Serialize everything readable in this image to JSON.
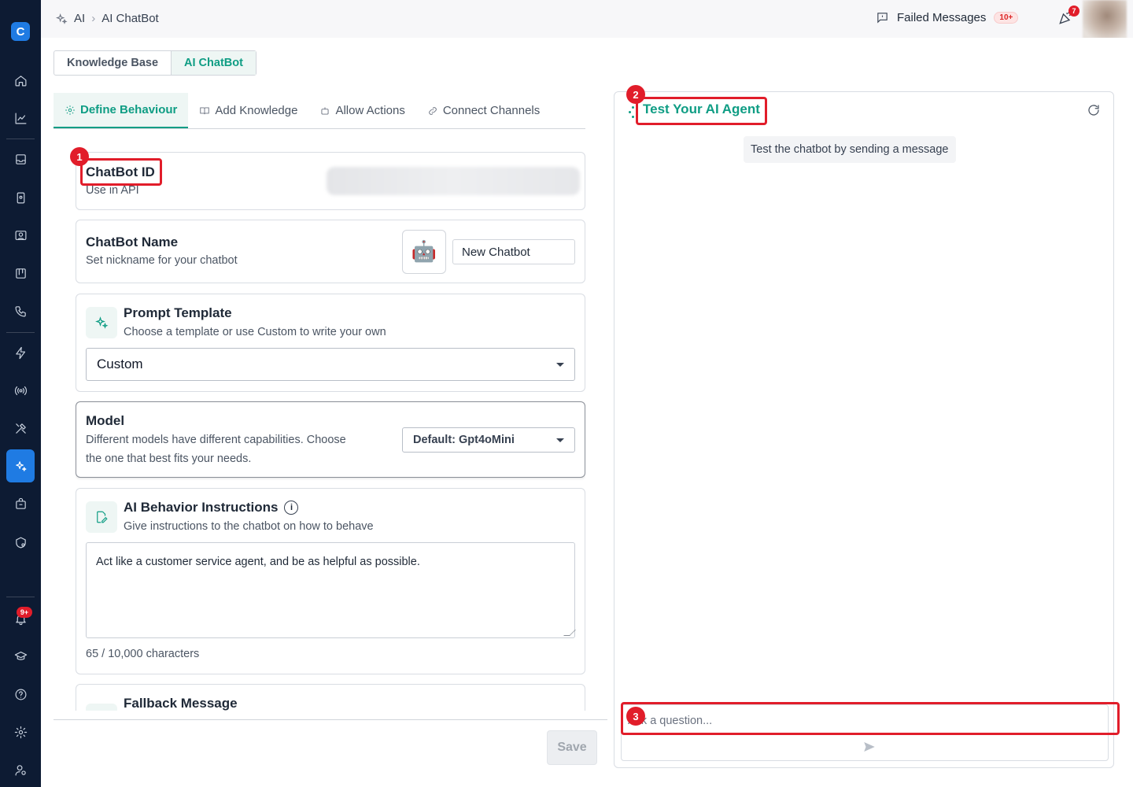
{
  "breadcrumb": {
    "root": "AI",
    "current": "AI ChatBot"
  },
  "topbar": {
    "failed_label": "Failed Messages",
    "failed_count": "10+",
    "notif_count": "7"
  },
  "sidebar": {
    "items": [
      "home-icon",
      "analytics-icon",
      "inbox-icon",
      "contacts-icon",
      "people-icon",
      "board-icon",
      "phone-icon",
      "flash-icon",
      "broadcast-icon",
      "tools-icon",
      "ai-icon",
      "bag-icon",
      "shield-icon",
      "bell-icon",
      "education-icon",
      "help-icon",
      "gear-icon",
      "user-settings-icon"
    ],
    "notification_badge": "9+"
  },
  "segment": {
    "knowledge": "Knowledge Base",
    "chatbot": "AI ChatBot"
  },
  "tabs": [
    "Define Behaviour",
    "Add Knowledge",
    "Allow Actions",
    "Connect Channels"
  ],
  "cards": {
    "id": {
      "title": "ChatBot ID",
      "sub": "Use in API"
    },
    "name": {
      "title": "ChatBot Name",
      "sub": "Set nickname for your chatbot",
      "value": "New Chatbot",
      "emoji": "🤖"
    },
    "prompt": {
      "title": "Prompt Template",
      "sub": "Choose a template or use Custom to write your own",
      "value": "Custom"
    },
    "model": {
      "title": "Model",
      "sub_line1": "Different models have different capabilities. Choose",
      "sub_line2": "the one that best fits your needs.",
      "value": "Default: Gpt4oMini"
    },
    "behavior": {
      "title": "AI Behavior Instructions",
      "sub": "Give instructions to the chatbot on how to behave",
      "text": "Act like a customer service agent, and be as helpful as possible.",
      "count": "65 / 10,000 characters"
    },
    "fallback": {
      "title": "Fallback Message"
    }
  },
  "save_label": "Save",
  "test_panel": {
    "title": "Test Your AI Agent",
    "hint": "Test the chatbot by sending a message",
    "placeholder": "Ask a question..."
  },
  "annotations": [
    "1",
    "2",
    "3"
  ],
  "colors": {
    "accent": "#0f9d84",
    "sidebar": "#0d1b33",
    "active": "#1f7be3",
    "annotation": "#e11d2a"
  }
}
